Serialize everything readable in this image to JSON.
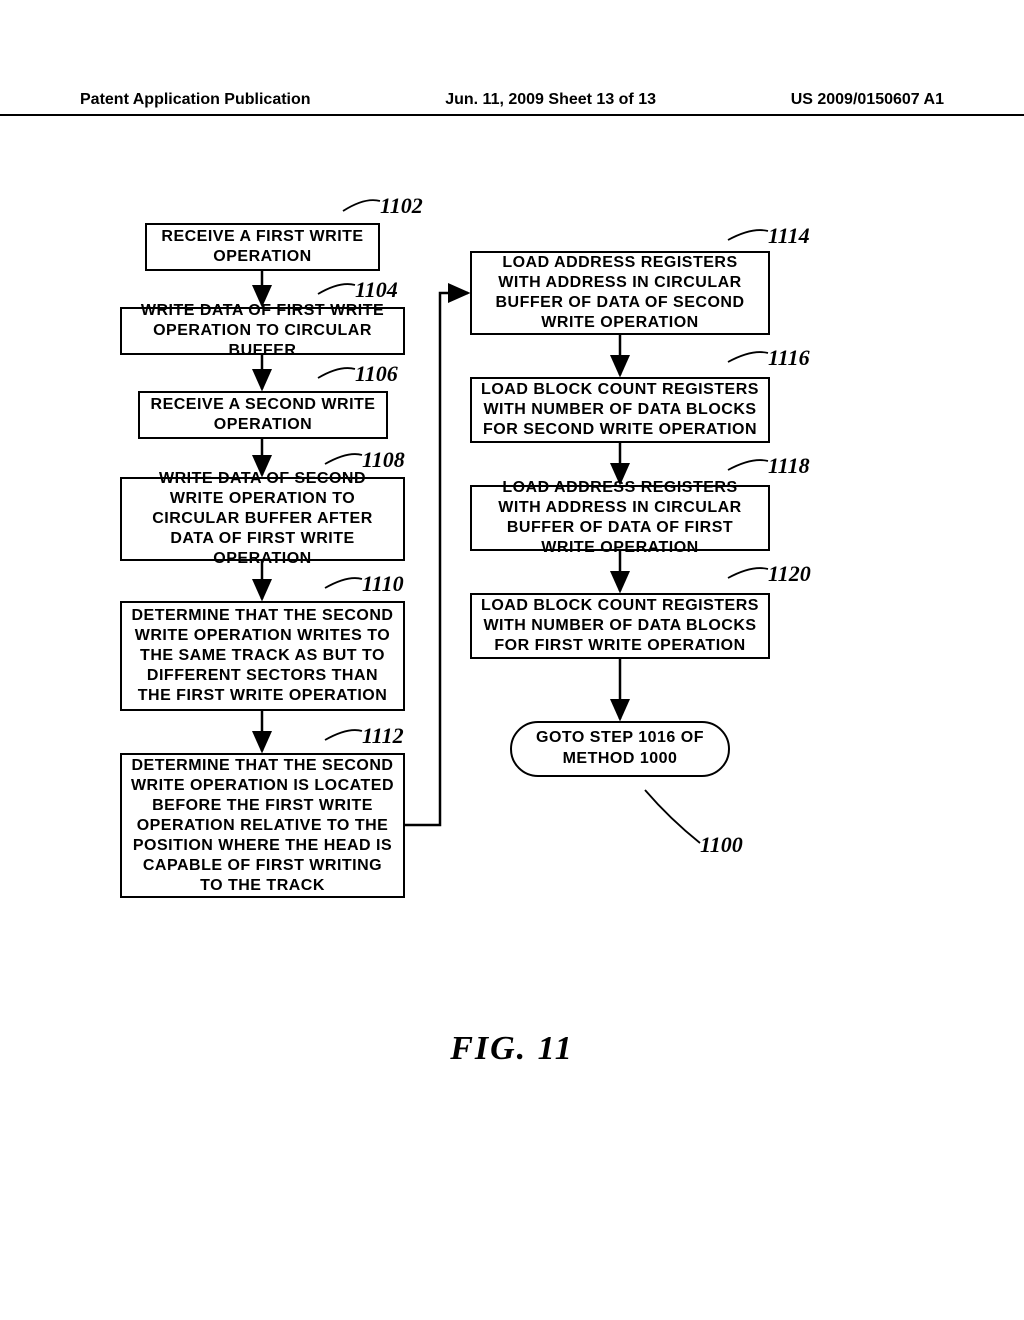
{
  "header": {
    "left": "Patent Application Publication",
    "mid": "Jun. 11, 2009  Sheet 13 of 13",
    "right": "US 2009/0150607 A1"
  },
  "labels": {
    "l1102": "1102",
    "l1104": "1104",
    "l1106": "1106",
    "l1108": "1108",
    "l1110": "1110",
    "l1112": "1112",
    "l1114": "1114",
    "l1116": "1116",
    "l1118": "1118",
    "l1120": "1120",
    "l1100": "1100"
  },
  "boxes": {
    "b1102": "RECEIVE A FIRST WRITE OPERATION",
    "b1104": "WRITE DATA OF FIRST WRITE OPERATION TO CIRCULAR BUFFER",
    "b1106": "RECEIVE A SECOND WRITE OPERATION",
    "b1108": "WRITE DATA OF SECOND WRITE OPERATION TO CIRCULAR BUFFER AFTER DATA OF FIRST WRITE OPERATION",
    "b1110": "DETERMINE THAT THE SECOND WRITE OPERATION WRITES TO THE SAME TRACK AS BUT TO DIFFERENT SECTORS THAN THE FIRST WRITE OPERATION",
    "b1112": "DETERMINE THAT THE SECOND WRITE OPERATION IS LOCATED BEFORE THE FIRST WRITE OPERATION RELATIVE TO THE POSITION WHERE THE HEAD IS CAPABLE OF FIRST WRITING TO THE TRACK",
    "b1114": "LOAD ADDRESS REGISTERS WITH ADDRESS IN CIRCULAR BUFFER OF DATA OF SECOND WRITE OPERATION",
    "b1116": "LOAD BLOCK COUNT REGISTERS WITH NUMBER OF DATA BLOCKS FOR SECOND WRITE OPERATION",
    "b1118": "LOAD ADDRESS REGISTERS WITH ADDRESS IN CIRCULAR BUFFER OF DATA OF FIRST WRITE OPERATION",
    "b1120": "LOAD BLOCK COUNT REGISTERS WITH NUMBER OF DATA BLOCKS FOR FIRST WRITE OPERATION",
    "goto": "GOTO STEP 1016 OF METHOD 1000"
  },
  "figure": "FIG.  11"
}
